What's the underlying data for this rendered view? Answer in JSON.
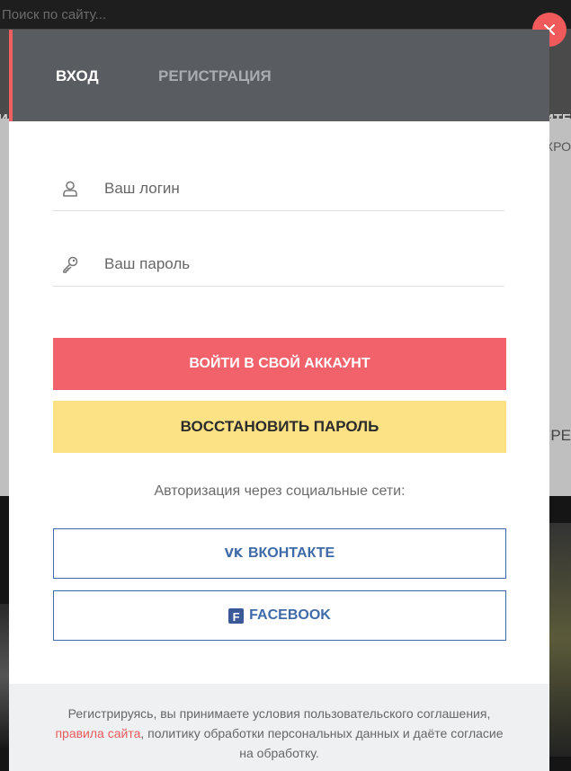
{
  "background": {
    "search_placeholder": "Поиск по сайту...",
    "nav_left_fragment": "И",
    "nav_right_fragment": "ИТЕ",
    "right_fragment_1": "ХРО",
    "right_fragment_2": "РЕ"
  },
  "modal": {
    "tabs": {
      "login": "Вход",
      "register": "Регистрация"
    },
    "login_field": {
      "placeholder": "Ваш логин",
      "value": ""
    },
    "password_field": {
      "placeholder": "Ваш пароль",
      "value": ""
    },
    "signin_button": "Войти в свой аккаунт",
    "restore_button": "Восстановить пароль",
    "social_title": "Авторизация через социальные сети:",
    "social": {
      "vk_label": "ВКонтакте",
      "vk_mark": "vk",
      "fb_label": "Facebook",
      "fb_mark": "f"
    },
    "footer": {
      "text_before": "Регистрируясь, вы принимаете условия пользовательского соглашения, ",
      "link": "правила сайта",
      "text_after": ", политику обработки персональных данных и даёте согласие на обработку."
    }
  },
  "colors": {
    "accent_red": "#f2626a",
    "accent_yellow": "#fde185",
    "header_grey": "#595c60",
    "social_blue": "#3f6aa8"
  },
  "icons": {
    "close": "close-icon",
    "user": "user-icon",
    "key": "key-icon",
    "vk": "vk-icon",
    "facebook": "facebook-icon"
  }
}
